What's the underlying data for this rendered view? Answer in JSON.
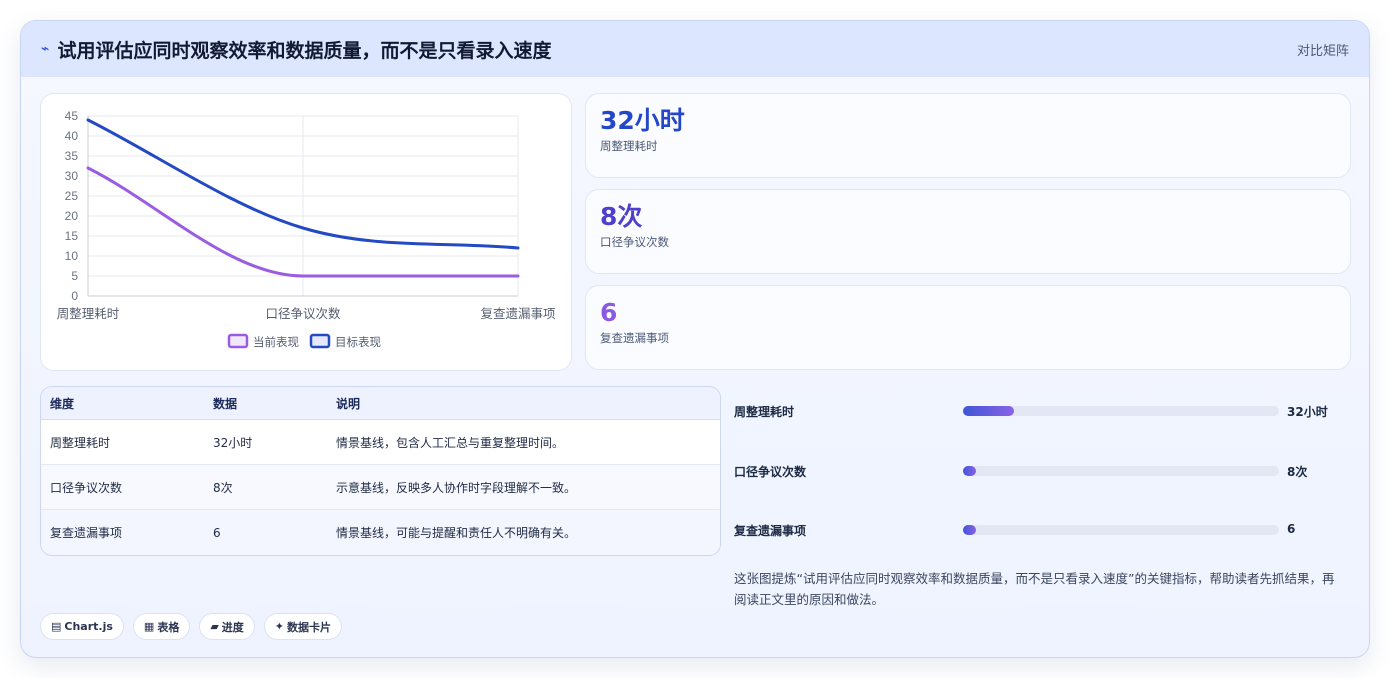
{
  "header": {
    "icon": "lightning-icon",
    "title": "试用评估应同时观察效率和数据质量，而不是只看录入速度",
    "right_label": "对比矩阵"
  },
  "chart_data": {
    "type": "line",
    "categories": [
      "周整理耗时",
      "口径争议次数",
      "复查遗漏事项"
    ],
    "series": [
      {
        "name": "当前表现",
        "values": [
          32,
          5,
          5
        ],
        "color": "#9a5ce0"
      },
      {
        "name": "目标表现",
        "values": [
          44,
          17,
          12
        ],
        "color": "#2349c4"
      }
    ],
    "ylim": [
      0,
      45
    ],
    "yticks": [
      "0",
      "5",
      "10",
      "15",
      "20",
      "25",
      "30",
      "35",
      "40",
      "45"
    ],
    "grid": true,
    "legend_position": "bottom"
  },
  "stats": [
    {
      "value": "32小时",
      "label": "周整理耗时",
      "color": "#2447c7"
    },
    {
      "value": "8次",
      "label": "口径争议次数",
      "color": "#4e3fcf"
    },
    {
      "value": "6",
      "label": "复查遗漏事项",
      "color": "#8b5ae3"
    }
  ],
  "table": {
    "headers": [
      "维度",
      "数据",
      "说明"
    ],
    "rows": [
      [
        "周整理耗时",
        "32小时",
        "情景基线，包含人工汇总与重复整理时间。"
      ],
      [
        "口径争议次数",
        "8次",
        "示意基线，反映多人协作时字段理解不一致。"
      ],
      [
        "复查遗漏事项",
        "6",
        "情景基线，可能与提醒和责任人不明确有关。"
      ]
    ]
  },
  "progress": [
    {
      "label": "周整理耗时",
      "value": "32小时",
      "fraction": 0.16
    },
    {
      "label": "口径争议次数",
      "value": "8次",
      "fraction": 0.04
    },
    {
      "label": "复查遗漏事项",
      "value": "6",
      "fraction": 0.04
    }
  ],
  "summary": "这张图提炼“试用评估应同时观察效率和数据质量，而不是只看录入速度”的关键指标，帮助读者先抓结果，再阅读正文里的原因和做法。",
  "chips": [
    {
      "icon": "chart-icon",
      "glyph": "▤",
      "label": "Chart.js"
    },
    {
      "icon": "table-icon",
      "glyph": "▦",
      "label": "表格"
    },
    {
      "icon": "progress-icon",
      "glyph": "▰",
      "label": "进度"
    },
    {
      "icon": "sparkle-icon",
      "glyph": "✦",
      "label": "数据卡片"
    }
  ]
}
